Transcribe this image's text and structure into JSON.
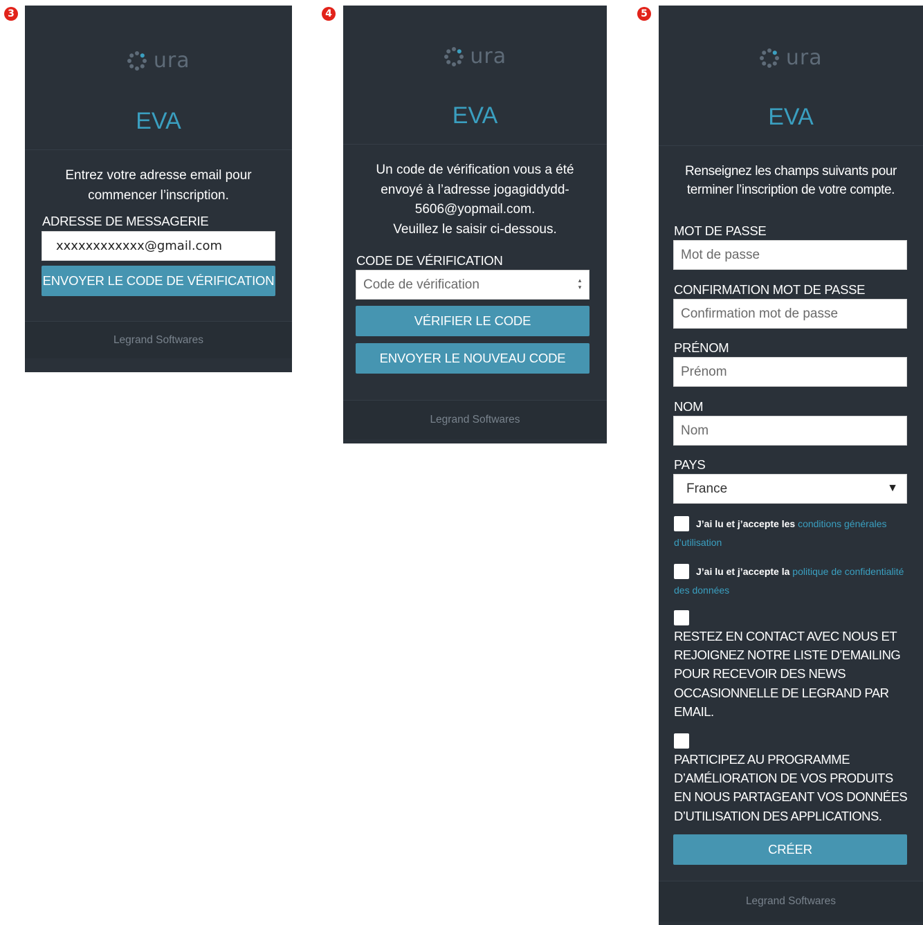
{
  "steps": [
    "3",
    "4",
    "5"
  ],
  "brand": {
    "logo_text": "ura",
    "app_name": "EVA",
    "footer": "Legrand Softwares",
    "accent": "#3a9fc0",
    "button": "#4695b1"
  },
  "screen3": {
    "intro": "Entrez votre adresse email pour commencer l’inscription.",
    "email_label": "ADRESSE DE MESSAGERIE",
    "email_value": "xxxxxxxxxxxx@gmail.com",
    "send_button": "ENVOYER LE CODE DE VÉRIFICATION"
  },
  "screen4": {
    "intro_line1": "Un code de vérification vous a été",
    "intro_line2": "envoyé à l’adresse jogagiddydd-",
    "intro_line3": "5606@yopmail.com.",
    "intro_line4": "Veuillez le saisir ci-dessous.",
    "code_label": "CODE DE VÉRIFICATION",
    "code_placeholder": "Code de vérification",
    "verify_button": "VÉRIFIER LE CODE",
    "resend_button": "ENVOYER LE NOUVEAU CODE"
  },
  "screen5": {
    "intro": "Renseignez les champs suivants pour terminer l’inscription de votre compte.",
    "password_label": "MOT DE PASSE",
    "password_placeholder": "Mot de passe",
    "confirm_label": "CONFIRMATION MOT DE PASSE",
    "confirm_placeholder": "Confirmation mot de passe",
    "firstname_label": "PRÉNOM",
    "firstname_placeholder": "Prénom",
    "lastname_label": "NOM",
    "lastname_placeholder": "Nom",
    "country_label": "PAYS",
    "country_value": "France",
    "terms_prefix": "J’ai lu et j’accepte les",
    "terms_link": "conditions générales d’utilisation",
    "privacy_prefix": "J’ai lu et j’accepte la",
    "privacy_link": "politique de confidentialité des données",
    "newsletter_text": "RESTEZ EN CONTACT AVEC NOUS ET REJOIGNEZ NOTRE LISTE D’EMAILING POUR RECEVOIR DES NEWS OCCASIONNELLE DE LEGRAND PAR EMAIL.",
    "program_text": "PARTICIPEZ AU PROGRAMME D’AMÉLIORATION DE VOS PRODUITS EN NOUS PARTAGEANT VOS DONNÉES D’UTILISATION DES APPLICATIONS.",
    "create_button": "CRÉER"
  }
}
